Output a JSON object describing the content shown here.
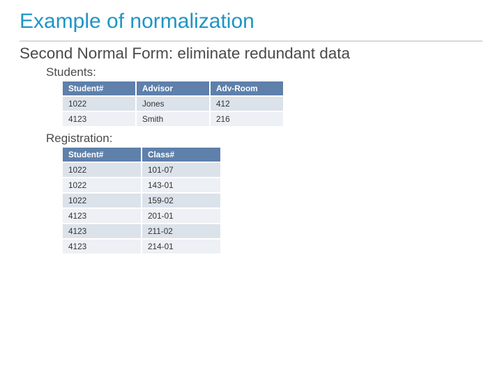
{
  "title": "Example of normalization",
  "subtitle": "Second Normal Form: eliminate redundant data",
  "students": {
    "label": "Students:",
    "headers": [
      "Student#",
      "Advisor",
      "Adv-Room"
    ],
    "rows": [
      [
        "1022",
        "Jones",
        "412"
      ],
      [
        "4123",
        "Smith",
        "216"
      ]
    ]
  },
  "registration": {
    "label": "Registration:",
    "headers": [
      "Student#",
      "Class#"
    ],
    "rows": [
      [
        "1022",
        "101-07"
      ],
      [
        "1022",
        "143-01"
      ],
      [
        "1022",
        "159-02"
      ],
      [
        "4123",
        "201-01"
      ],
      [
        "4123",
        "211-02"
      ],
      [
        "4123",
        "214-01"
      ]
    ]
  }
}
